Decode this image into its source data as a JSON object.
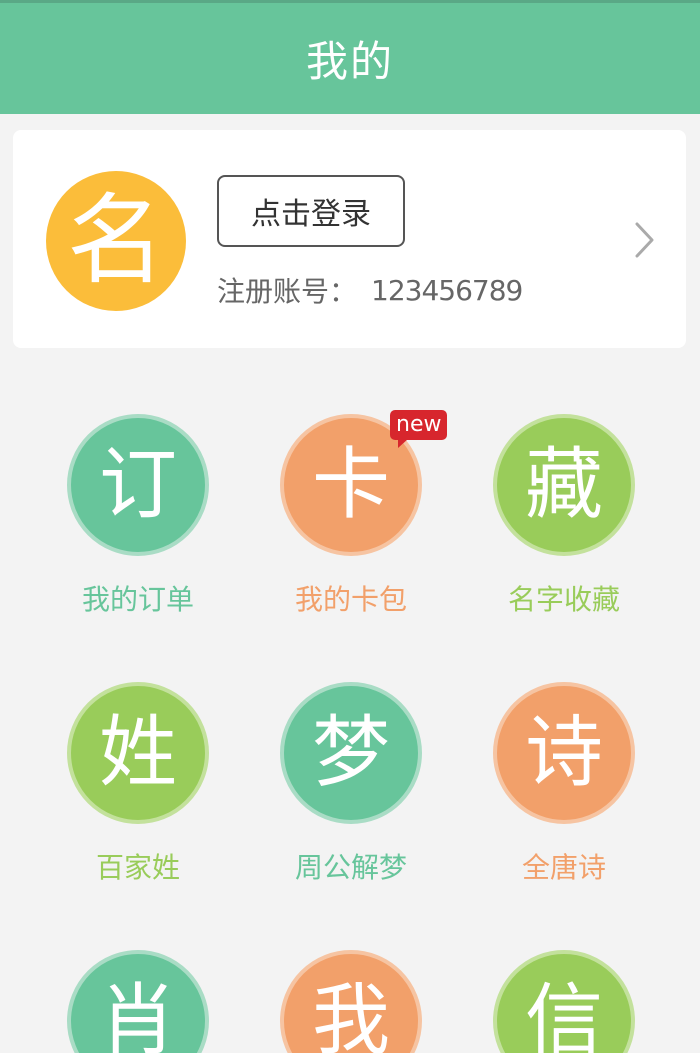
{
  "header": {
    "title": "我的"
  },
  "profile": {
    "avatar_char": "名",
    "login_label": "点击登录",
    "account_label": "注册账号：",
    "account_value": "123456789"
  },
  "grid": {
    "items": [
      {
        "char": "订",
        "label": "我的订单",
        "color": "#67c59b",
        "border": "#a9dcc5",
        "label_color": "#67c59b"
      },
      {
        "char": "卡",
        "label": "我的卡包",
        "color": "#f2a06a",
        "border": "#f6c4a2",
        "label_color": "#f2a06a",
        "badge": "new"
      },
      {
        "char": "藏",
        "label": "名字收藏",
        "color": "#99cc5a",
        "border": "#c3e19c",
        "label_color": "#99cc5a"
      },
      {
        "char": "姓",
        "label": "百家姓",
        "color": "#99cc5a",
        "border": "#c3e19c",
        "label_color": "#99cc5a"
      },
      {
        "char": "梦",
        "label": "周公解梦",
        "color": "#67c59b",
        "border": "#a9dcc5",
        "label_color": "#67c59b"
      },
      {
        "char": "诗",
        "label": "全唐诗",
        "color": "#f2a06a",
        "border": "#f6c4a2",
        "label_color": "#f2a06a"
      },
      {
        "char": "肖",
        "label": "",
        "color": "#67c59b",
        "border": "#a9dcc5",
        "label_color": "#67c59b"
      },
      {
        "char": "我",
        "label": "",
        "color": "#f2a06a",
        "border": "#f6c4a2",
        "label_color": "#f2a06a"
      },
      {
        "char": "信",
        "label": "",
        "color": "#99cc5a",
        "border": "#c3e19c",
        "label_color": "#99cc5a"
      }
    ]
  },
  "colors": {
    "header_bg": "#67c59b",
    "page_bg": "#f3f3f3",
    "avatar_bg": "#fbbd3a",
    "badge_bg": "#d7262d"
  },
  "icons": {
    "chevron": "chevron-right-icon"
  }
}
